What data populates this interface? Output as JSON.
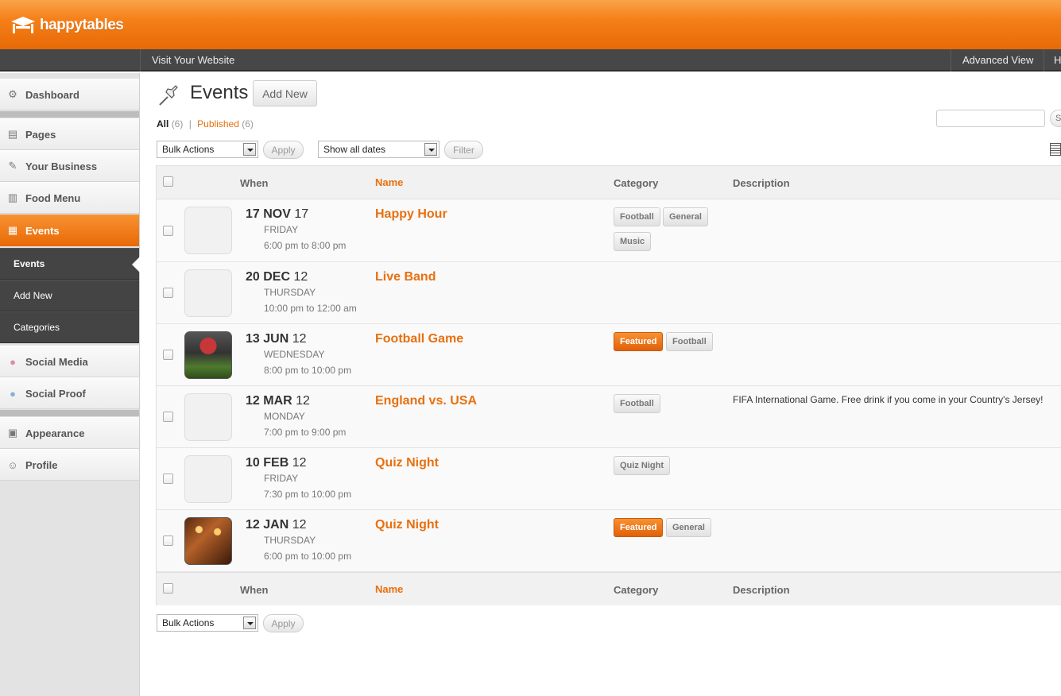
{
  "brand": {
    "name": "happytables"
  },
  "topbar": {
    "visit": "Visit Your Website",
    "advanced": "Advanced View",
    "help": "H"
  },
  "sidebar": {
    "items": [
      {
        "label": "Dashboard",
        "icon": "dashboard-icon"
      },
      {
        "label": "Pages",
        "icon": "pages-icon"
      },
      {
        "label": "Your Business",
        "icon": "pencil-icon"
      },
      {
        "label": "Food Menu",
        "icon": "book-icon"
      },
      {
        "label": "Events",
        "icon": "calendar-icon"
      },
      {
        "label": "Social Media",
        "icon": "user-icon"
      },
      {
        "label": "Social Proof",
        "icon": "users-icon"
      },
      {
        "label": "Appearance",
        "icon": "layout-icon"
      },
      {
        "label": "Profile",
        "icon": "profile-icon"
      }
    ],
    "subitems": [
      "Events",
      "Add New",
      "Categories"
    ]
  },
  "main": {
    "title": "Events",
    "add_new": "Add New",
    "filters": {
      "all": "All",
      "all_count": "(6)",
      "published": "Published",
      "published_count": "(6)"
    },
    "bulk_actions": "Bulk Actions",
    "apply": "Apply",
    "dates": "Show all dates",
    "filter": "Filter",
    "search_btn": "S"
  },
  "table": {
    "headers": {
      "when": "When",
      "name": "Name",
      "category": "Category",
      "description": "Description"
    },
    "rows": [
      {
        "day_num": "17",
        "month": "NOV",
        "year": "17",
        "weekday": "FRIDAY",
        "time": "6:00 pm to 8:00 pm",
        "name": "Happy Hour",
        "tags": [
          "Football",
          "General",
          "Music"
        ],
        "description": ""
      },
      {
        "day_num": "20",
        "month": "DEC",
        "year": "12",
        "weekday": "THURSDAY",
        "time": "10:00 pm to 12:00 am",
        "name": "Live Band",
        "tags": [],
        "description": ""
      },
      {
        "day_num": "13",
        "month": "JUN",
        "year": "12",
        "weekday": "WEDNESDAY",
        "time": "8:00 pm to 10:00 pm",
        "name": "Football Game",
        "tags": [
          "Featured",
          "Football"
        ],
        "description": ""
      },
      {
        "day_num": "12",
        "month": "MAR",
        "year": "12",
        "weekday": "MONDAY",
        "time": "7:00 pm to 9:00 pm",
        "name": "England vs. USA",
        "tags": [
          "Football"
        ],
        "description": "FIFA International Game. Free drink if you come in your Country's Jersey!"
      },
      {
        "day_num": "10",
        "month": "FEB",
        "year": "12",
        "weekday": "FRIDAY",
        "time": "7:30 pm to 10:00 pm",
        "name": "Quiz Night",
        "tags": [
          "Quiz Night"
        ],
        "description": ""
      },
      {
        "day_num": "12",
        "month": "JAN",
        "year": "12",
        "weekday": "THURSDAY",
        "time": "6:00 pm to 10:00 pm",
        "name": "Quiz Night",
        "tags": [
          "Featured",
          "General"
        ],
        "description": ""
      }
    ]
  },
  "colors": {
    "accent": "#e8700f",
    "header": "#f57f18",
    "topbar": "#474747"
  }
}
